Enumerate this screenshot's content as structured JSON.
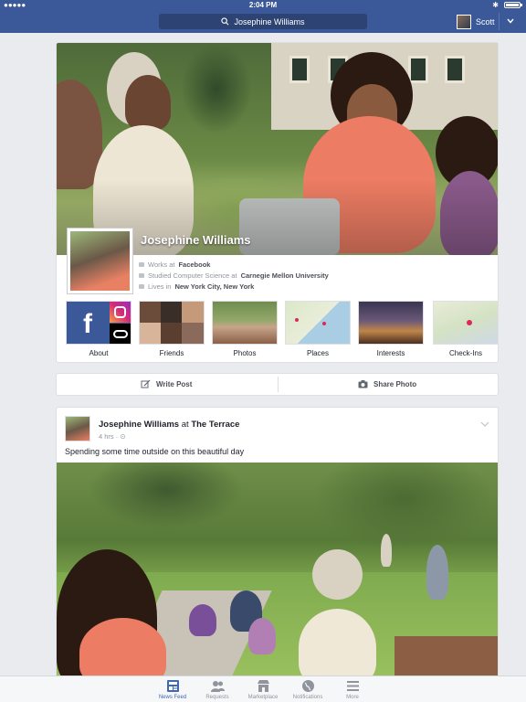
{
  "status_bar": {
    "signal": "●●●●●",
    "time": "2:04 PM",
    "bluetooth": "✱"
  },
  "nav": {
    "search_text": "Josephine Williams",
    "user_name": "Scott"
  },
  "profile": {
    "name": "Josephine Williams",
    "work": {
      "prefix": "Works at",
      "value": "Facebook"
    },
    "study": {
      "prefix": "Studied Computer Science at",
      "value": "Carnegie Mellon University"
    },
    "home": {
      "prefix": "Lives in",
      "value": "New York City, New York"
    },
    "tiles": [
      {
        "label": "About"
      },
      {
        "label": "Friends"
      },
      {
        "label": "Photos"
      },
      {
        "label": "Places"
      },
      {
        "label": "Interests"
      },
      {
        "label": "Check-Ins"
      }
    ]
  },
  "composer": {
    "write_post": "Write Post",
    "share_photo": "Share Photo"
  },
  "post": {
    "author": "Josephine Williams",
    "at": "at",
    "place": "The Terrace",
    "time": "4 hrs · ⊙",
    "text": "Spending some time outside on this beautiful day"
  },
  "tabbar": [
    {
      "label": "News Feed",
      "active": true
    },
    {
      "label": "Requests"
    },
    {
      "label": "Marketplace"
    },
    {
      "label": "Notifications"
    },
    {
      "label": "More"
    }
  ],
  "colors": {
    "brand": "#3b5998",
    "active": "#4267b2",
    "background": "#e9ebee"
  }
}
